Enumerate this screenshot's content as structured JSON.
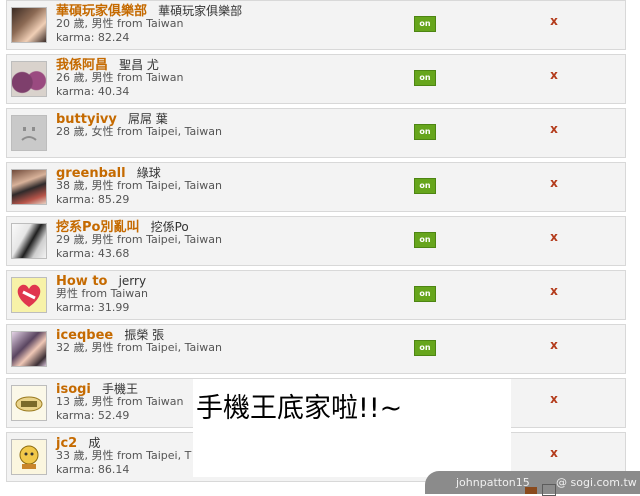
{
  "rows": [
    {
      "username": "華碩玩家俱樂部",
      "display": "華碩玩家俱樂部",
      "info": "20 歲, 男性 from Taiwan",
      "karma": "karma: 82.24",
      "status": "on",
      "avatar": "avatar-girl-photo"
    },
    {
      "username": "我係阿昌",
      "display": "聖昌 尤",
      "info": "26 歲, 男性 from Taiwan",
      "karma": "karma: 40.34",
      "status": "on",
      "avatar": "avatar-figurine-photo"
    },
    {
      "username": "buttyivy",
      "display": "屌屌 葉",
      "info": "28 歲, 女性 from Taipei, Taiwan",
      "karma": "",
      "status": "on",
      "avatar": "avatar-default-sad-face"
    },
    {
      "username": "greenball",
      "display": "綠球",
      "info": "38 歲, 男性 from Taipei, Taiwan",
      "karma": "karma: 85.29",
      "status": "on",
      "avatar": "avatar-people-photo"
    },
    {
      "username": "挖系Po別亂叫",
      "display": "挖係Po",
      "info": "29 歲, 男性 from Taipei, Taiwan",
      "karma": "karma: 43.68",
      "status": "on",
      "avatar": "avatar-person-photo"
    },
    {
      "username": "How to",
      "display": "jerry",
      "info": "男性 from Taiwan",
      "karma": "karma: 31.99",
      "status": "on",
      "avatar": "avatar-heart"
    },
    {
      "username": "iceqbee",
      "display": "振榮 張",
      "info": "32 歲, 男性 from Taipei, Taiwan",
      "karma": "",
      "status": "on",
      "avatar": "avatar-couple-photo"
    },
    {
      "username": "isogi",
      "display": "手機王",
      "info": "13 歲, 男性 from Taiwan",
      "karma": "karma: 52.49",
      "status": "",
      "avatar": "avatar-sogi-logo"
    },
    {
      "username": "jc2",
      "display": "成",
      "info": "33 歲, 男性 from Taipei, T",
      "karma": "karma: 86.14",
      "status": "",
      "avatar": "avatar-cartoon-logo"
    }
  ],
  "delete_glyph": "x",
  "overlay_text": "手機王底家啦!!~",
  "footer": {
    "user": "johnpatton15",
    "site": "@ sogi.com.tw"
  },
  "colors": {
    "username": "#c56a00",
    "on_badge": "#66a51c",
    "delete": "#b33a1a",
    "row_bg": "#f3f3f3"
  }
}
